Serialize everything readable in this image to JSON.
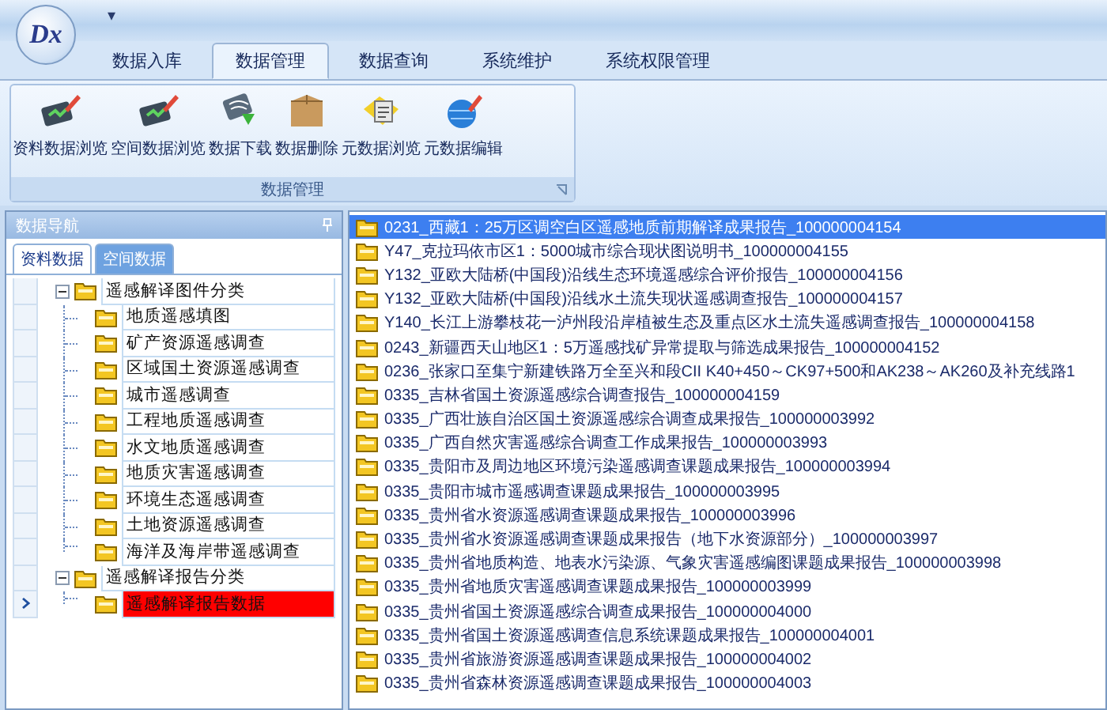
{
  "app": {
    "logo": "Dx",
    "quick_access": "▾"
  },
  "ribbon_tabs": [
    {
      "label": "数据入库",
      "selected": false
    },
    {
      "label": "数据管理",
      "selected": true
    },
    {
      "label": "数据查询",
      "selected": false
    },
    {
      "label": "系统维护",
      "selected": false
    },
    {
      "label": "系统权限管理",
      "selected": false
    }
  ],
  "ribbon_group": {
    "title": "数据管理",
    "buttons": [
      {
        "label": "资料数据浏览",
        "kind": "browse"
      },
      {
        "label": "空间数据浏览",
        "kind": "browse"
      },
      {
        "label": "数据下载",
        "kind": "download"
      },
      {
        "label": "数据删除",
        "kind": "delete"
      },
      {
        "label": "元数据浏览",
        "kind": "meta-browse"
      },
      {
        "label": "元数据编辑",
        "kind": "meta-edit"
      }
    ]
  },
  "navigator": {
    "title": "数据导航",
    "tabs": [
      {
        "label": "资料数据",
        "selected": true
      },
      {
        "label": "空间数据",
        "selected": false
      }
    ],
    "tree": [
      {
        "label": "遥感解译图件分类",
        "expanded": true,
        "selected": false,
        "children": [
          {
            "label": "地质遥感填图",
            "selected": false
          },
          {
            "label": "矿产资源遥感调查",
            "selected": false
          },
          {
            "label": "区域国土资源遥感调查",
            "selected": false
          },
          {
            "label": "城市遥感调查",
            "selected": false
          },
          {
            "label": "工程地质遥感调查",
            "selected": false
          },
          {
            "label": "水文地质遥感调查",
            "selected": false
          },
          {
            "label": "地质灾害遥感调查",
            "selected": false
          },
          {
            "label": "环境生态遥感调查",
            "selected": false
          },
          {
            "label": "土地资源遥感调查",
            "selected": false
          },
          {
            "label": "海洋及海岸带遥感调查",
            "selected": false
          }
        ]
      },
      {
        "label": "遥感解译报告分类",
        "expanded": true,
        "selected": false,
        "children": [
          {
            "label": "遥感解译报告数据",
            "selected": true
          }
        ]
      }
    ]
  },
  "files": [
    {
      "name": "0231_西藏1：25万区调空白区遥感地质前期解译成果报告_100000004154",
      "selected": true
    },
    {
      "name": "Y47_克拉玛依市区1：5000城市综合现状图说明书_100000004155",
      "selected": false
    },
    {
      "name": "Y132_亚欧大陆桥(中国段)沿线生态环境遥感综合评价报告_100000004156",
      "selected": false
    },
    {
      "name": "Y132_亚欧大陆桥(中国段)沿线水土流失现状遥感调查报告_100000004157",
      "selected": false
    },
    {
      "name": "Y140_长江上游攀枝花一泸州段沿岸植被生态及重点区水土流失遥感调查报告_100000004158",
      "selected": false
    },
    {
      "name": "0243_新疆西天山地区1：5万遥感找矿异常提取与筛选成果报告_100000004152",
      "selected": false
    },
    {
      "name": "0236_张家口至集宁新建铁路万全至兴和段CII K40+450～CK97+500和AK238～AK260及补充线路1",
      "selected": false
    },
    {
      "name": "0335_吉林省国土资源遥感综合调查报告_100000004159",
      "selected": false
    },
    {
      "name": "0335_广西壮族自治区国土资源遥感综合调查成果报告_100000003992",
      "selected": false
    },
    {
      "name": "0335_广西自然灾害遥感综合调查工作成果报告_100000003993",
      "selected": false
    },
    {
      "name": "0335_贵阳市及周边地区环境污染遥感调查课题成果报告_100000003994",
      "selected": false
    },
    {
      "name": "0335_贵阳市城市遥感调查课题成果报告_100000003995",
      "selected": false
    },
    {
      "name": "0335_贵州省水资源遥感调查课题成果报告_100000003996",
      "selected": false
    },
    {
      "name": "0335_贵州省水资源遥感调查课题成果报告（地下水资源部分）_100000003997",
      "selected": false
    },
    {
      "name": "0335_贵州省地质构造、地表水污染源、气象灾害遥感编图课题成果报告_100000003998",
      "selected": false
    },
    {
      "name": "0335_贵州省地质灾害遥感调查课题成果报告_100000003999",
      "selected": false
    },
    {
      "name": "0335_贵州省国土资源遥感综合调查成果报告_100000004000",
      "selected": false
    },
    {
      "name": "0335_贵州省国土资源遥感调查信息系统课题成果报告_100000004001",
      "selected": false
    },
    {
      "name": "0335_贵州省旅游资源遥感调查课题成果报告_100000004002",
      "selected": false
    },
    {
      "name": "0335_贵州省森林资源遥感调查课题成果报告_100000004003",
      "selected": false
    }
  ]
}
